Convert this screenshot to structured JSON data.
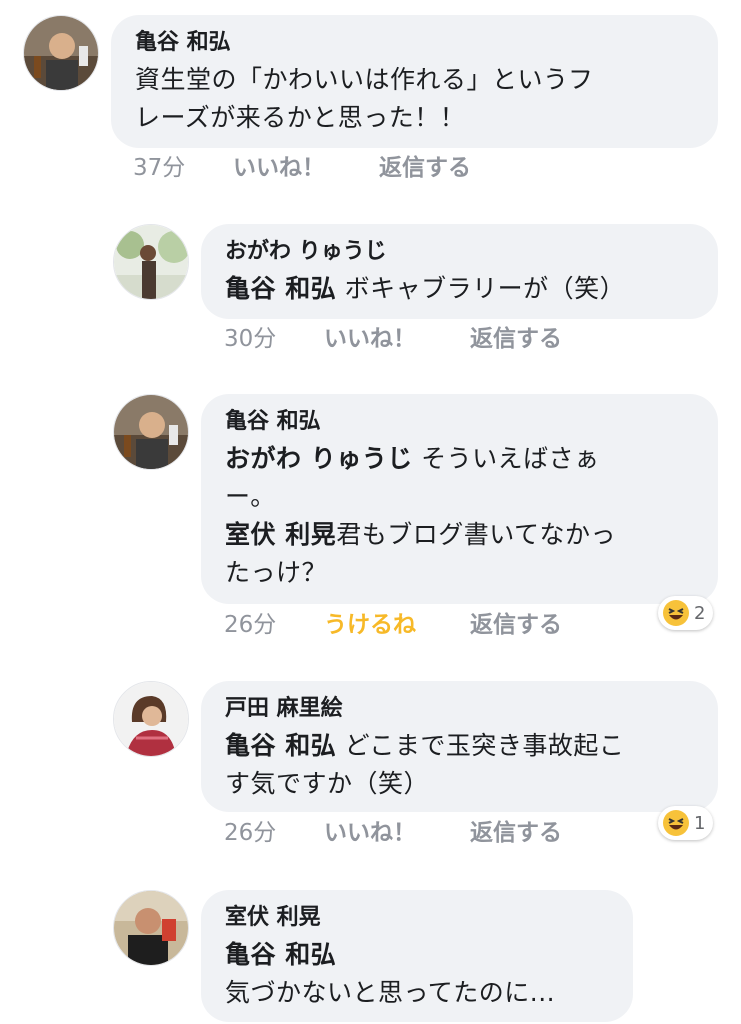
{
  "comments": [
    {
      "author": "亀谷 和弘",
      "line1": "資生堂の「かわいいは作れる」というフ",
      "line2": "レーズが来るかと思った！！",
      "time": "37分",
      "like": "いいね！",
      "reply": "返信する"
    },
    {
      "author": "おがわ りゅうじ",
      "mention": "亀谷 和弘",
      "text": " ボキャブラリーが（笑）",
      "time": "30分",
      "like": "いいね！",
      "reply": "返信する"
    },
    {
      "author": "亀谷 和弘",
      "mention1": "おがわ りゅうじ",
      "text1": " そういえばさぁ",
      "line2": "ー。",
      "mention2": "室伏 利晃",
      "text2": "君もブログ書いてなかっ",
      "line4": "たっけ？",
      "time": "26分",
      "like": "うけるね",
      "reply": "返信する",
      "reaction_count": "2"
    },
    {
      "author": "戸田 麻里絵",
      "mention": "亀谷 和弘",
      "text": " どこまで玉突き事故起こ",
      "line2": "す気ですか（笑）",
      "time": "26分",
      "like": "いいね！",
      "reply": "返信する",
      "reaction_count": "1"
    },
    {
      "author": "室伏 利晃",
      "mention": "亀谷 和弘",
      "line2": "気づかないと思ってたのに..."
    }
  ],
  "colors": {
    "bubble": "#f0f2f5",
    "meta": "#90949c",
    "haha": "#f7b928"
  },
  "icons": {
    "avatar": "user-avatar-photo",
    "reaction": "haha-emoji-icon"
  }
}
